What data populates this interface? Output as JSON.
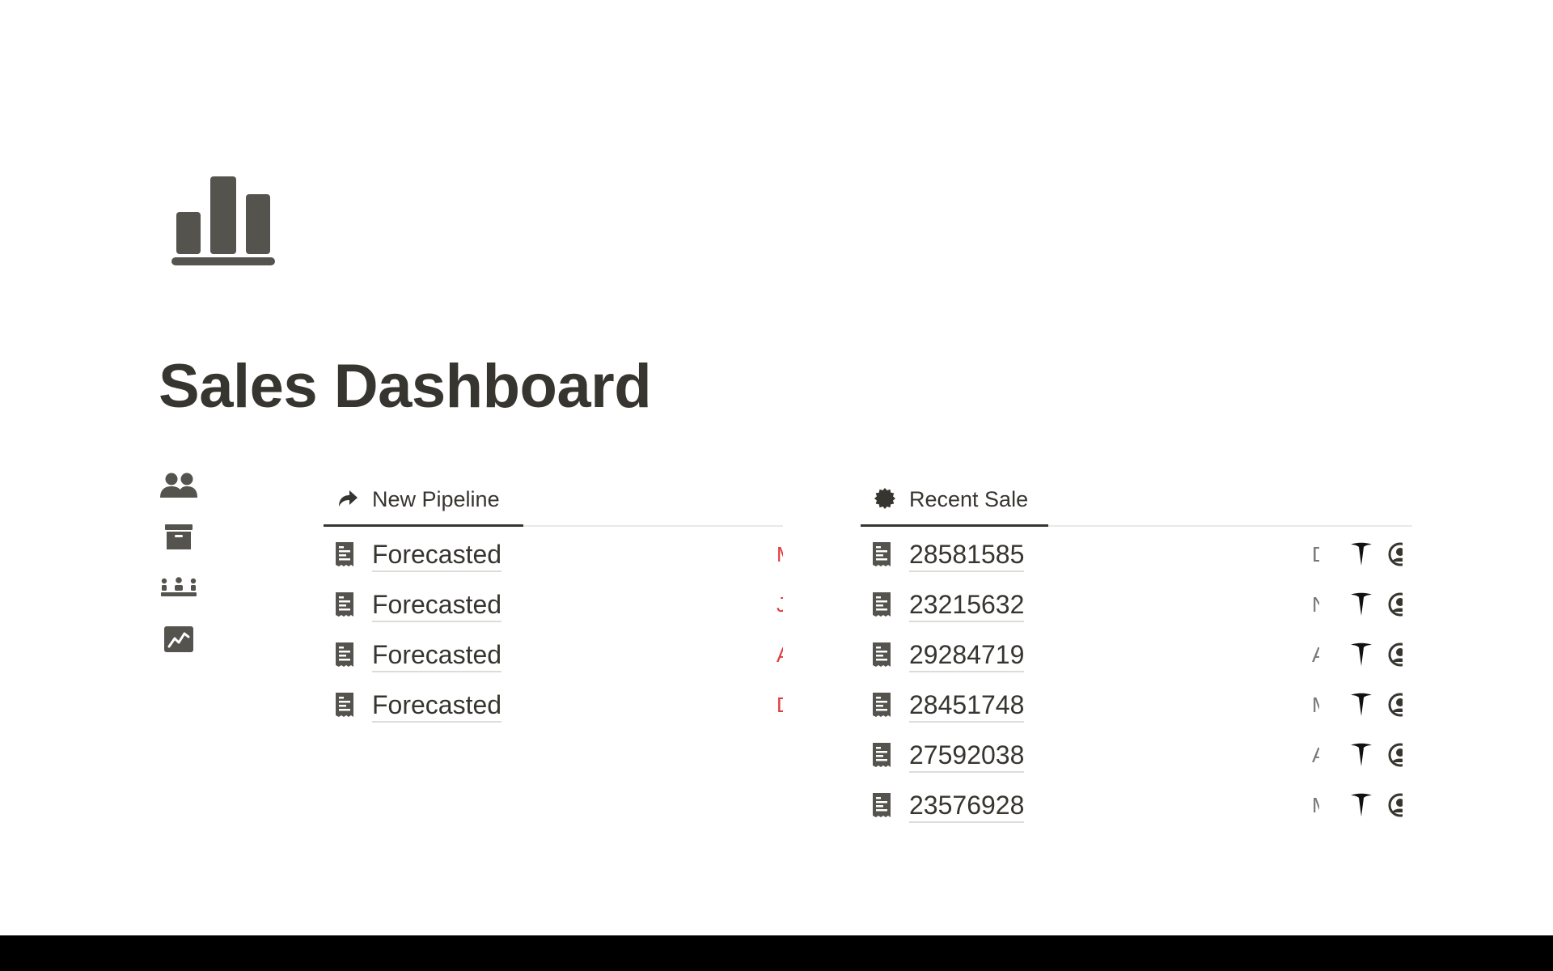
{
  "page": {
    "title": "Sales Dashboard",
    "icon": "bar-chart-icon"
  },
  "sidebar_icons": [
    "people-icon",
    "archive-box-icon",
    "team-meeting-icon",
    "line-chart-icon"
  ],
  "views": {
    "pipeline": {
      "tab_label": "New Pipeline",
      "tab_icon": "share-arrow-icon",
      "accent_color": "#e03e3e",
      "rows": [
        {
          "title": "Forecasted",
          "trailing": "M"
        },
        {
          "title": "Forecasted",
          "trailing": "J"
        },
        {
          "title": "Forecasted",
          "trailing": "A"
        },
        {
          "title": "Forecasted",
          "trailing": "D"
        }
      ]
    },
    "recent_sale": {
      "tab_label": "Recent Sale",
      "tab_icon": "badge-icon",
      "rows": [
        {
          "title": "28581585",
          "trailing": "D"
        },
        {
          "title": "23215632",
          "trailing": "N"
        },
        {
          "title": "29284719",
          "trailing": "A"
        },
        {
          "title": "28451748",
          "trailing": "M"
        },
        {
          "title": "27592038",
          "trailing": "A"
        },
        {
          "title": "23576928",
          "trailing": "M"
        }
      ]
    }
  },
  "colors": {
    "text": "#37352f",
    "icon": "#55534e",
    "accent_red": "#e03e3e"
  }
}
